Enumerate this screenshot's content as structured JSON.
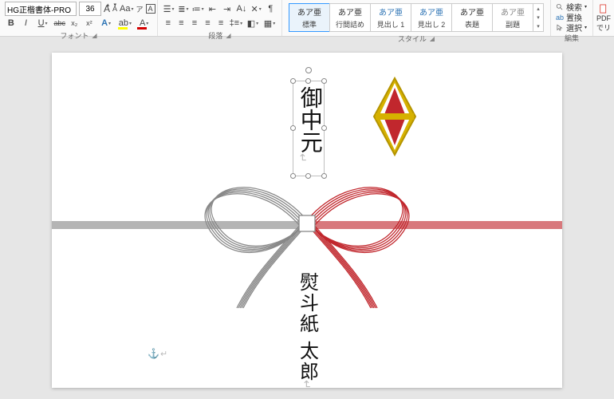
{
  "ribbon": {
    "font": {
      "label": "フォント",
      "name": "HG正楷書体-PRO",
      "size": "36",
      "grow": "A",
      "shrink": "A",
      "caseMenu": "Aa",
      "phonetic": "ア",
      "charBorder": "A",
      "clearFmt": "A",
      "bold": "B",
      "italic": "I",
      "underline": "U",
      "strike": "abc",
      "sub": "x₂",
      "sup": "x²",
      "effects": "A",
      "highlight": "ab",
      "fontColor": "A"
    },
    "para": {
      "label": "段落"
    },
    "styles": {
      "label": "スタイル",
      "items": [
        {
          "sample": "あア亜",
          "name": "標準",
          "selected": true
        },
        {
          "sample": "あア亜",
          "name": "行間詰め"
        },
        {
          "sample": "あア亜",
          "name": "見出し 1"
        },
        {
          "sample": "あア亜",
          "name": "見出し 2"
        },
        {
          "sample": "あア亜",
          "name": "表題"
        },
        {
          "sample": "あア亜",
          "name": "副題"
        }
      ]
    },
    "editing": {
      "label": "編集",
      "find": "検索",
      "replace": "置換",
      "select": "選択"
    },
    "pdf": {
      "line1": "PDF",
      "line2": "でリ"
    }
  },
  "doc": {
    "title": "御中元",
    "name": "熨斗紙 太郎"
  }
}
